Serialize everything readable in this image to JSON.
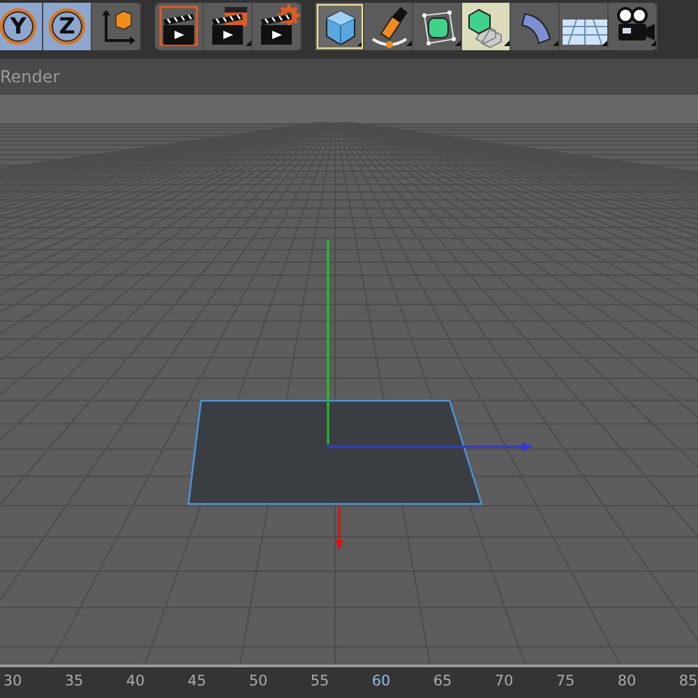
{
  "toolbar": {
    "groups": [
      {
        "buttons": [
          {
            "kind": "axis-letter",
            "label": "Y",
            "selected": true,
            "highlighted": false
          },
          {
            "kind": "axis-letter",
            "label": "Z",
            "selected": true,
            "highlighted": false
          },
          {
            "kind": "coordinate-system",
            "selected": false,
            "highlighted": false
          }
        ]
      },
      {
        "buttons": [
          {
            "kind": "render-view",
            "selected": false,
            "highlighted": false
          },
          {
            "kind": "render-picture",
            "selected": false,
            "highlighted": false
          },
          {
            "kind": "render-settings",
            "selected": false,
            "highlighted": false
          }
        ]
      },
      {
        "buttons": [
          {
            "kind": "cube",
            "selected": true,
            "highlighted": false
          },
          {
            "kind": "pen",
            "selected": false,
            "highlighted": false
          },
          {
            "kind": "subdivision",
            "selected": false,
            "highlighted": false
          },
          {
            "kind": "array",
            "selected": false,
            "highlighted": true
          },
          {
            "kind": "bend",
            "selected": false,
            "highlighted": false
          },
          {
            "kind": "floor",
            "selected": false,
            "highlighted": false
          },
          {
            "kind": "camera",
            "selected": false,
            "highlighted": false
          }
        ]
      }
    ]
  },
  "menu": {
    "items": [
      "Render"
    ]
  },
  "timeline": {
    "labels": [
      {
        "text": "30",
        "selected": false
      },
      {
        "text": "35",
        "selected": false
      },
      {
        "text": "40",
        "selected": false
      },
      {
        "text": "45",
        "selected": false
      },
      {
        "text": "50",
        "selected": false
      },
      {
        "text": "55",
        "selected": false
      },
      {
        "text": "60",
        "selected": true
      },
      {
        "text": "65",
        "selected": false
      },
      {
        "text": "70",
        "selected": false
      },
      {
        "text": "75",
        "selected": false
      },
      {
        "text": "80",
        "selected": false
      },
      {
        "text": "85",
        "selected": false
      }
    ]
  }
}
